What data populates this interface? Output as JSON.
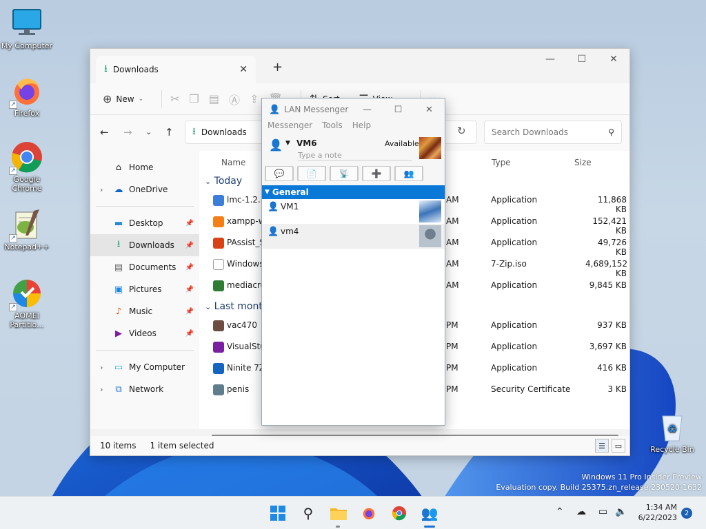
{
  "desktop": {
    "icons": [
      {
        "label": "My Computer"
      },
      {
        "label": "Firefox"
      },
      {
        "label": "Google Chrome"
      },
      {
        "label": "Notepad++"
      },
      {
        "label": "AOMEI Partitio..."
      },
      {
        "label": "Recycle Bin"
      }
    ],
    "watermark": {
      "line1": "Windows 11 Pro Insider Preview",
      "line2": "Evaluation copy. Build 25375.zn_release.230520-1632"
    }
  },
  "explorer": {
    "tab_title": "Downloads",
    "toolbar": {
      "new": "New",
      "sort": "Sort",
      "view": "View",
      "more": "···"
    },
    "address": "Downloads",
    "search_placeholder": "Search Downloads",
    "nav": {
      "home": "Home",
      "onedrive": "OneDrive",
      "desktop": "Desktop",
      "downloads": "Downloads",
      "documents": "Documents",
      "pictures": "Pictures",
      "music": "Music",
      "videos": "Videos",
      "mycomputer": "My Computer",
      "network": "Network"
    },
    "columns": {
      "name": "Name",
      "type": "Type",
      "size": "Size"
    },
    "groups": {
      "today": "Today",
      "lastmonth": "Last month"
    },
    "files": [
      {
        "name": "lmc-1.2.3",
        "time": "AM",
        "type": "Application",
        "size": "11,868 KB",
        "color": "#3b7dd8"
      },
      {
        "name": "xampp-w",
        "time": "AM",
        "type": "Application",
        "size": "152,421 KB",
        "color": "#f57f17"
      },
      {
        "name": "PAssist_St",
        "time": "AM",
        "type": "Application",
        "size": "49,726 KB",
        "color": "#d84315"
      },
      {
        "name": "Windows.",
        "time": "AM",
        "type": "7-Zip.iso",
        "size": "4,689,152 KB",
        "color": "#9e9e9e"
      },
      {
        "name": "mediacrea",
        "time": "AM",
        "type": "Application",
        "size": "9,845 KB",
        "color": "#2e7d32"
      },
      {
        "name": "vac470",
        "time": "PM",
        "type": "Application",
        "size": "937 KB",
        "color": "#6d4c41"
      },
      {
        "name": "VisualStud",
        "time": "PM",
        "type": "Application",
        "size": "3,697 KB",
        "color": "#7b1fa2"
      },
      {
        "name": "Ninite 7Zi",
        "time": "PM",
        "type": "Application",
        "size": "416 KB",
        "color": "#1565c0"
      },
      {
        "name": "penis",
        "time": "PM",
        "type": "Security Certificate",
        "size": "3 KB",
        "color": "#607d8b"
      }
    ],
    "status": {
      "count": "10 items",
      "selected": "1 item selected"
    }
  },
  "lan": {
    "title": "LAN Messenger",
    "menu": {
      "messenger": "Messenger",
      "tools": "Tools",
      "help": "Help"
    },
    "user": {
      "name": "VM6",
      "status": "Available",
      "note_placeholder": "Type a note"
    },
    "group": "General",
    "contacts": [
      {
        "name": "VM1"
      },
      {
        "name": "vm4"
      }
    ]
  },
  "taskbar": {
    "time": "1:34 AM",
    "date": "6/22/2023",
    "notifications": "2"
  }
}
